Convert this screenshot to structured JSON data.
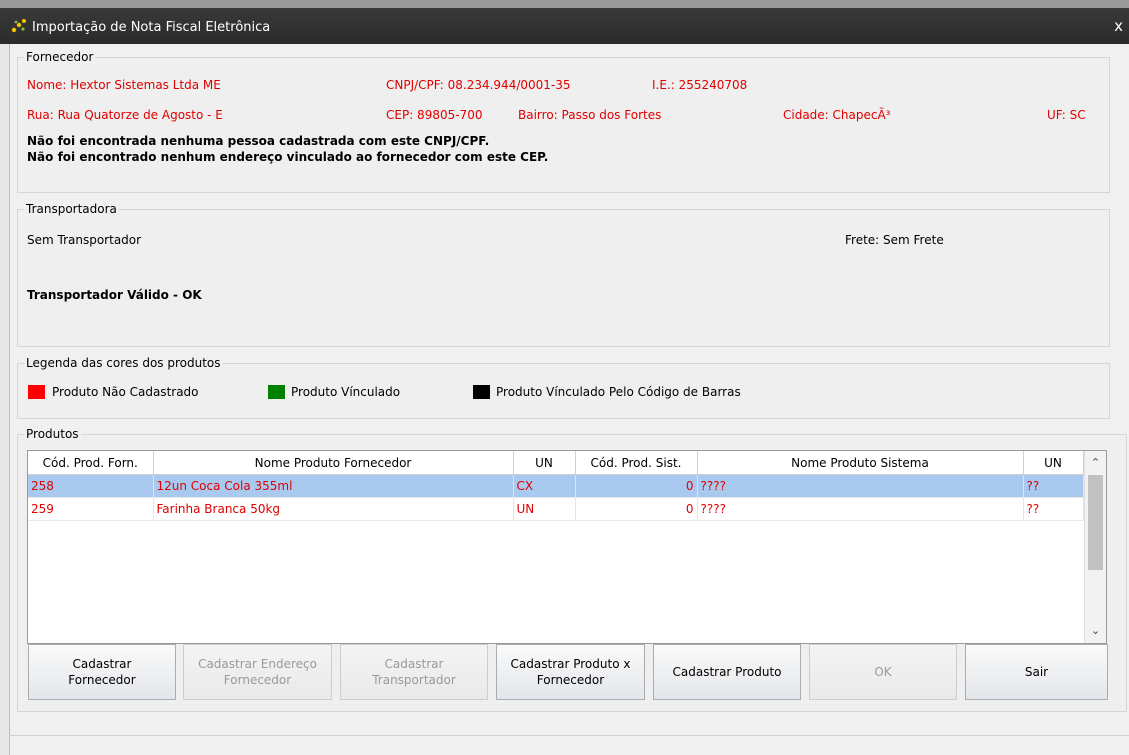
{
  "window": {
    "title": "Importação de Nota Fiscal Eletrônica",
    "close": "x"
  },
  "fornecedor": {
    "group_title": "Fornecedor",
    "nome": "Nome: Hextor Sistemas Ltda ME",
    "cnpj": "CNPJ/CPF: 08.234.944/0001-35",
    "ie": "I.E.: 255240708",
    "rua": "Rua: Rua Quatorze de Agosto - E",
    "cep": "CEP: 89805-700",
    "bairro": "Bairro: Passo dos Fortes",
    "cidade": "Cidade: ChapecÃ³",
    "uf": "UF: SC",
    "msg1": "Não foi encontrada nenhuma pessoa cadastrada com este CNPJ/CPF.",
    "msg2": "Não foi encontrado nenhum endereço vinculado ao fornecedor com este CEP."
  },
  "transportadora": {
    "group_title": "Transportadora",
    "nome": "Sem Transportador",
    "frete": "Frete: Sem Frete",
    "status": "Transportador Válido - OK"
  },
  "legenda": {
    "group_title": "Legenda das cores dos produtos",
    "items": [
      {
        "label": "Produto Não Cadastrado",
        "color": "#ff0000"
      },
      {
        "label": "Produto Vínculado",
        "color": "#008000"
      },
      {
        "label": "Produto Vínculado Pelo Código de Barras",
        "color": "#000000"
      }
    ]
  },
  "produtos": {
    "group_title": "Produtos",
    "columns": [
      "Cód. Prod. Forn.",
      "Nome Produto Fornecedor",
      "UN",
      "Cód. Prod. Sist.",
      "Nome Produto Sistema",
      "UN"
    ],
    "rows": [
      {
        "cod_forn": "258",
        "nome_forn": "12un Coca Cola 355ml",
        "un_forn": "CX",
        "cod_sist": "0",
        "nome_sist": "????",
        "un_sist": "??"
      },
      {
        "cod_forn": "259",
        "nome_forn": "Farinha Branca 50kg",
        "un_forn": "UN",
        "cod_sist": "0",
        "nome_sist": "????",
        "un_sist": "??"
      }
    ]
  },
  "buttons": {
    "cadastrar_fornecedor_1": "Cadastrar",
    "cadastrar_fornecedor_2": "Fornecedor",
    "cadastrar_endereco_1": "Cadastrar Endereço",
    "cadastrar_endereco_2": "Fornecedor",
    "cadastrar_transportador_1": "Cadastrar",
    "cadastrar_transportador_2": "Transportador",
    "cadastrar_produto_fornecedor_1": "Cadastrar Produto x",
    "cadastrar_produto_fornecedor_2": "Fornecedor",
    "cadastrar_produto": "Cadastrar Produto",
    "ok": "OK",
    "sair": "Sair"
  }
}
